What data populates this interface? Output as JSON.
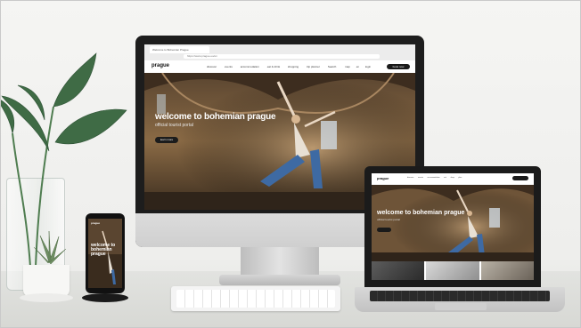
{
  "colors": {
    "background": "#f3f3f1",
    "hero_dark": "#3a2c1e",
    "hero_warm": "#8a6a45",
    "jeans_blue": "#3e6aa3",
    "leaf_green": "#3f6b45"
  },
  "imac": {
    "browser": {
      "tab_title": "Welcome to Bohemian Prague",
      "address": "https://www.prague.eu/en"
    },
    "site": {
      "logo": "prague",
      "nav_links": [
        "discover",
        "events",
        "accommodation",
        "eat & drink",
        "shopping",
        "trip planner",
        "Search"
      ],
      "nav_right": [
        "map",
        "en",
        "login"
      ],
      "cta": "book now",
      "hero_title": "welcome to bohemian prague",
      "hero_subtitle": "official tourist portal",
      "hero_button": "learn more"
    }
  },
  "laptop": {
    "logo": "prague",
    "nav_links": [
      "discover",
      "events",
      "accommodation",
      "eat",
      "shop",
      "plan"
    ],
    "hero_title": "welcome to bohemian prague",
    "hero_subtitle": "official tourist portal"
  },
  "phone": {
    "logo": "prague",
    "hero_title": "welcome to bohemian prague"
  }
}
